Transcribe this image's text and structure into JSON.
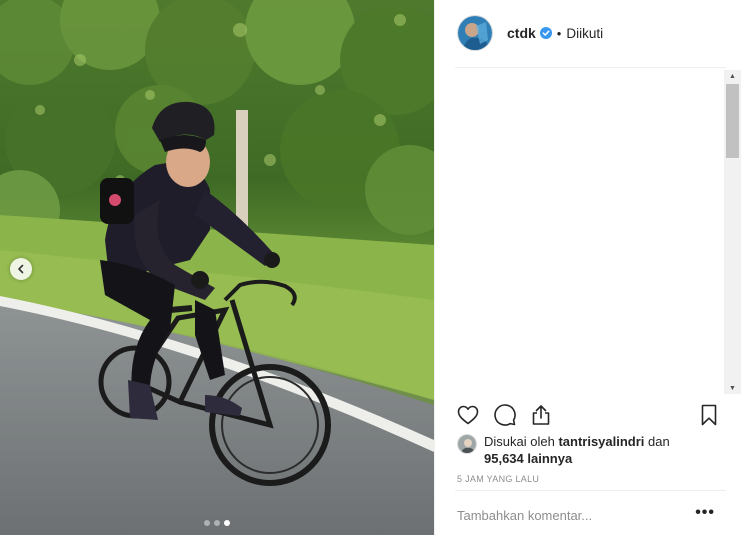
{
  "post": {
    "image_alt": "Woman cycling on a road bike along a leafy roadside",
    "carousel": {
      "total": 3,
      "active_index": 2
    },
    "prev_icon": "chevron-left-icon"
  },
  "header": {
    "username": "ctdk",
    "verified_icon": "verified-badge-icon",
    "separator": "•",
    "follow_status": "Diikuti"
  },
  "actions": {
    "like_icon": "heart-icon",
    "comment_icon": "comment-icon",
    "share_icon": "share-icon",
    "save_icon": "bookmark-icon"
  },
  "likes": {
    "prefix": "Disukai oleh",
    "user": "tantrisyalindri",
    "conjunction": "dan",
    "count": "95,634",
    "suffix": "lainnya"
  },
  "timestamp": "5 JAM YANG LALU",
  "comment": {
    "placeholder": "Tambahkan komentar...",
    "more_label": "•••"
  },
  "colors": {
    "text": "#262626",
    "muted": "#8e8e8e",
    "verified": "#3897f0",
    "divider": "#efefef"
  }
}
